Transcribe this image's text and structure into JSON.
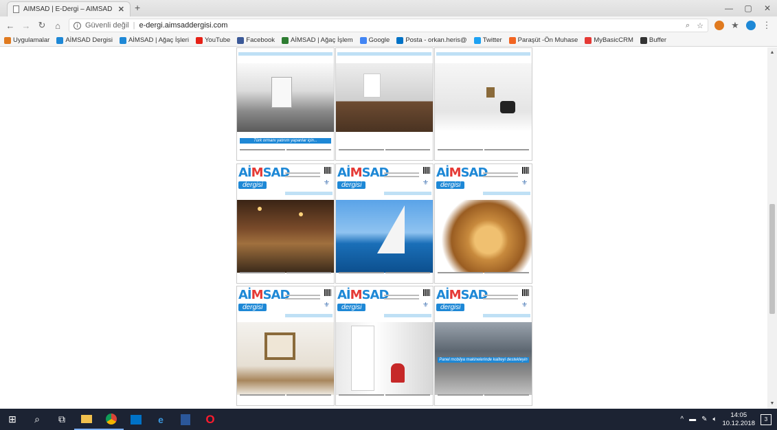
{
  "browser": {
    "tab_title": "AİMSAD | E-Dergi – AİMSAD Der",
    "address": {
      "security": "Güvenli değil",
      "url": "e-dergi.aimsaddergisi.com"
    },
    "bookmarks": [
      {
        "label": "Uygulamalar",
        "color": "#e07a1f"
      },
      {
        "label": "AİMSAD Dergisi",
        "color": "#1e88d6"
      },
      {
        "label": "AİMSAD | Ağaç İşleri",
        "color": "#1e88d6"
      },
      {
        "label": "YouTube",
        "color": "#e62117"
      },
      {
        "label": "Facebook",
        "color": "#3b5998"
      },
      {
        "label": "AİMSAD | Ağaç İşlem",
        "color": "#2e7d32"
      },
      {
        "label": "Google",
        "color": "#4285f4"
      },
      {
        "label": "Posta - orkan.heris@",
        "color": "#0072c6"
      },
      {
        "label": "Twitter",
        "color": "#1da1f2"
      },
      {
        "label": "Paraşüt -Ön Muhase",
        "color": "#f26522"
      },
      {
        "label": "MyBasicCRM",
        "color": "#e53935"
      },
      {
        "label": "Buffer",
        "color": "#333333"
      }
    ]
  },
  "magazine": {
    "logo_main": "AİMSAD",
    "logo_sub": "dergisi",
    "covers": [
      {
        "photo": "factory",
        "banner": "Türk ormanı yatırım yapanlar için..."
      },
      {
        "photo": "livingroom",
        "banner": ""
      },
      {
        "photo": "chair",
        "banner": ""
      },
      {
        "photo": "library",
        "banner": ""
      },
      {
        "photo": "sail",
        "banner": ""
      },
      {
        "photo": "wood",
        "banner": ""
      },
      {
        "photo": "table",
        "banner": ""
      },
      {
        "photo": "door",
        "banner": ""
      },
      {
        "photo": "warehouse",
        "banner": "Panel mobilya makinelerinde kaliteyi destekleyin"
      }
    ]
  },
  "taskbar": {
    "time": "14:05",
    "date": "10.12.2018",
    "notifications": "3"
  }
}
